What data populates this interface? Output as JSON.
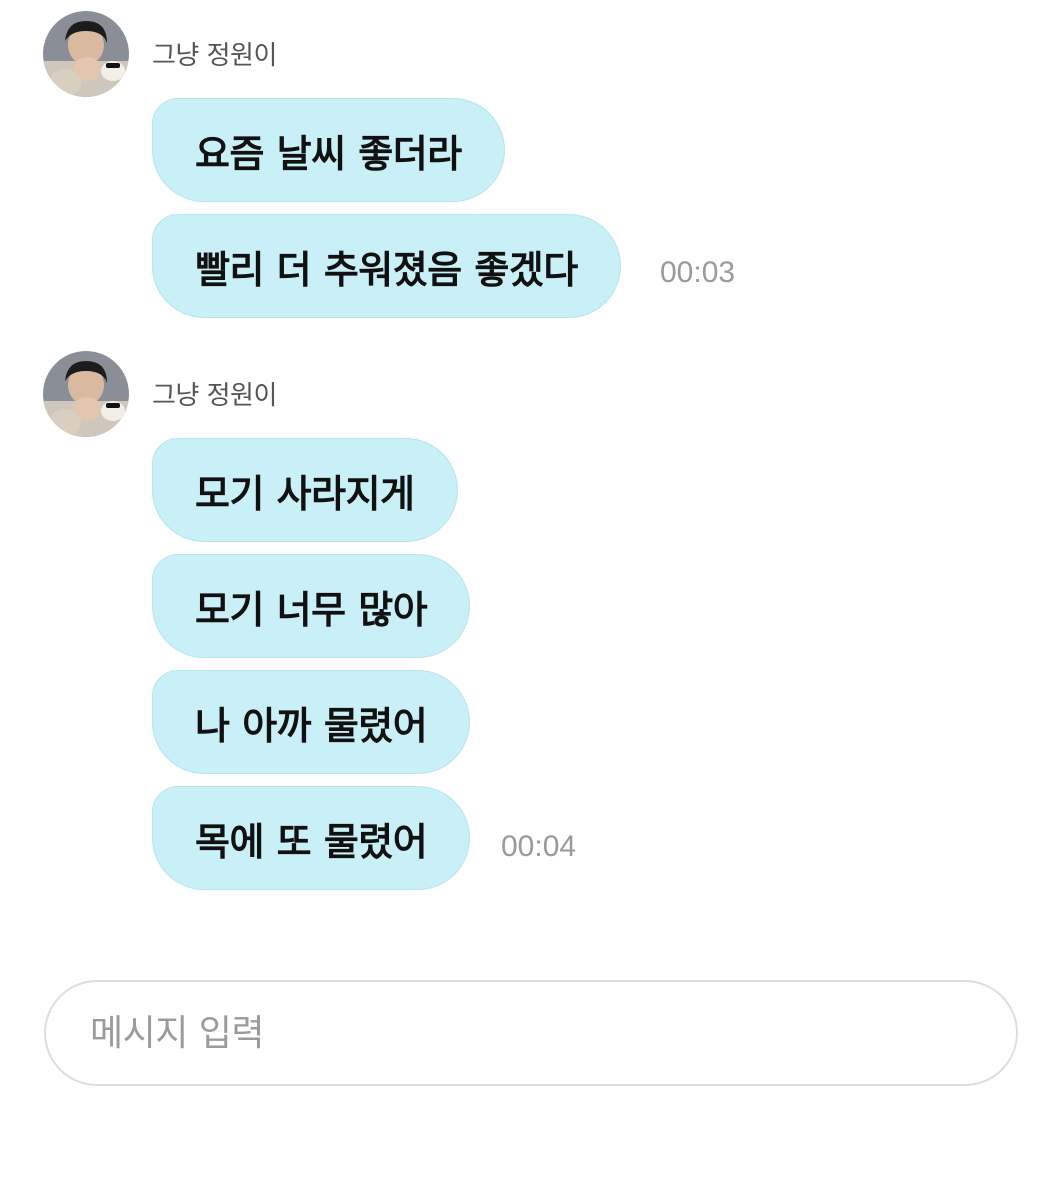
{
  "groups": [
    {
      "sender": "그냥 정원이",
      "avatar_icon": "profile-photo",
      "messages": [
        "요즘 날씨 좋더라",
        "빨리 더 추워졌음 좋겠다"
      ],
      "time": "00:03"
    },
    {
      "sender": "그냥 정원이",
      "avatar_icon": "profile-photo",
      "messages": [
        "모기 사라지게",
        "모기 너무 많아",
        "나 아까 물렸어",
        "목에 또 물렸어"
      ],
      "time": "00:04"
    }
  ],
  "composer": {
    "placeholder": "메시지 입력"
  },
  "colors": {
    "bubble": "#c9f0f6",
    "bubble_border": "#b6e5ee",
    "time": "#9a9a9a",
    "sender": "#555555"
  }
}
